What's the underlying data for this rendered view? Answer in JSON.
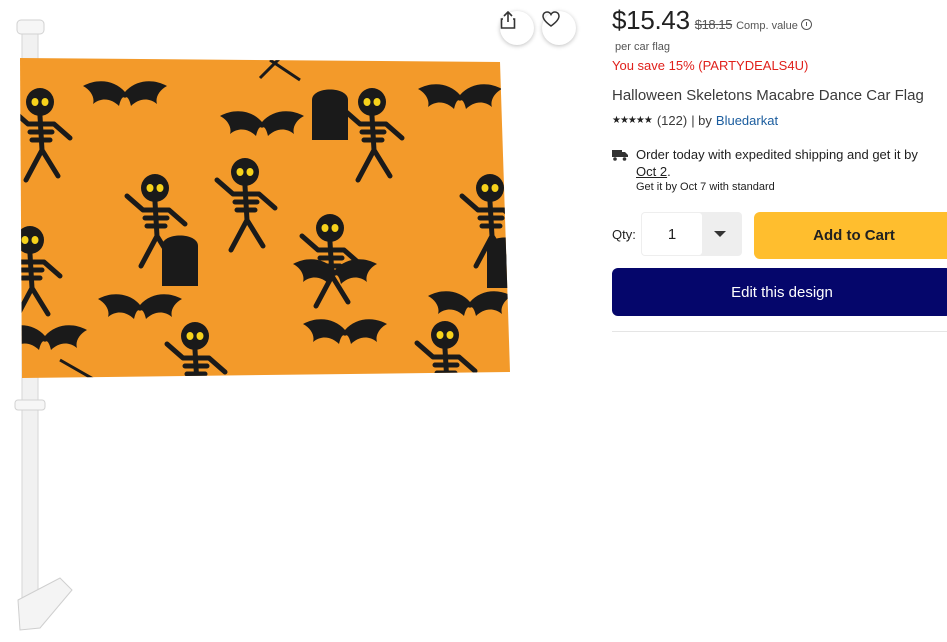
{
  "product": {
    "price": "$15.43",
    "original_price": "$18.15",
    "comp_label": "Comp. value",
    "per_unit": "per car flag",
    "savings": "You save 15% (PARTYDEALS4U)",
    "title": "Halloween Skeletons Macabre Dance Car Flag",
    "stars": "★★★★★",
    "review_count": "(122)",
    "by_label": "| by",
    "seller": "Bluedarkat"
  },
  "shipping": {
    "line1": "Order today with expedited shipping and get it by",
    "expedited_date": "Oct 2",
    "period": ".",
    "standard": "Get it by Oct 7 with standard"
  },
  "purchase": {
    "qty_label": "Qty:",
    "qty_value": "1",
    "add_to_cart": "Add to Cart",
    "edit_design": "Edit this design"
  },
  "image": {
    "icons": [
      "share-icon",
      "heart-icon",
      "truck-icon",
      "info-icon",
      "chevron-down-icon"
    ],
    "flag_color": "#f39a2a",
    "pattern_color": "#1a1a1a",
    "eye_color": "#f6d21b"
  }
}
